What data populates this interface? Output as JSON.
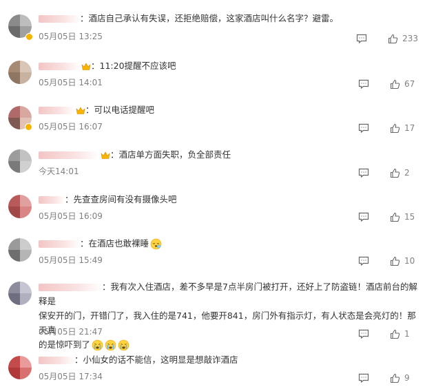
{
  "comments": [
    {
      "text": "：酒店自己承认有失误，还拒绝赔偿，这家酒店叫什么名字？避雷。",
      "time": "05月05日 13:25",
      "likes": "233",
      "avatar_colors": [
        "#8a8a8a",
        "#bdbdbd",
        "#6b6b6b",
        "#a0a0a0"
      ],
      "vip": true,
      "badge": false
    },
    {
      "text": "：11:20提醒不应该吧",
      "time": "05月05日 14:01",
      "likes": "67",
      "avatar_colors": [
        "#a58b76",
        "#d9c6b8",
        "#8f7663",
        "#c8b2a0"
      ],
      "vip": false,
      "badge": true
    },
    {
      "text": "：可以电话提醒吧",
      "time": "05月05日 16:07",
      "likes": "17",
      "avatar_colors": [
        "#b06a6a",
        "#d8a7a0",
        "#7e5a52",
        "#e3c1b5"
      ],
      "vip": true,
      "badge": true
    },
    {
      "text": "：酒店单方面失职，负全部责任",
      "time": "今天14:01",
      "likes": "2",
      "avatar_colors": [
        "#9c9c9c",
        "#c2c2c2",
        "#7a7a7a",
        "#d0d0d0"
      ],
      "vip": false,
      "badge": true
    },
    {
      "text": "：先查查房间有没有摄像头吧",
      "time": "05月05日 16:09",
      "likes": "15",
      "avatar_colors": [
        "#b85a5a",
        "#e0a0a0",
        "#a34848",
        "#d98585"
      ],
      "vip": false,
      "badge": false
    },
    {
      "text": "：在酒店也敢裸睡",
      "time": "05月05日 15:49",
      "likes": "10",
      "avatar_colors": [
        "#9a9a9a",
        "#cccccc",
        "#6f6f6f",
        "#b5b5b5"
      ],
      "vip": false,
      "badge": false
    },
    {
      "text_line1": "：我有次入住酒店，差不多早是7点半房门被打开，还好上了防盗链！酒店前台的解释是",
      "text_line2": "保安开的门，开错门了，我入住的是741，他要开841，房门外有指示灯，有人状态是会亮灯的！那天真",
      "text_line3": "的是惊吓到了",
      "time": "05月05日 21:47",
      "likes": "1",
      "avatar_colors": [
        "#8c8c9c",
        "#c6c6d2",
        "#6e6e80",
        "#b0b0c0"
      ],
      "vip": false,
      "badge": false
    },
    {
      "text": "：小仙女的话不能信，这明显是想敲诈酒店",
      "time": "05月05日 17:34",
      "likes": "9",
      "avatar_colors": [
        "#c44b4b",
        "#e99a9a",
        "#b03a3a",
        "#d97070"
      ],
      "vip": false,
      "badge": false
    }
  ],
  "icons": {
    "reply": "comment-reply-icon",
    "like": "thumbs-up-icon",
    "vip": "crown-icon",
    "emoji_sleep": "sleeping-emoji-icon",
    "emoji_cry": "crying-emoji-icon"
  },
  "colors": {
    "text": "#333333",
    "meta": "#808080",
    "vip": "#f6b400"
  }
}
